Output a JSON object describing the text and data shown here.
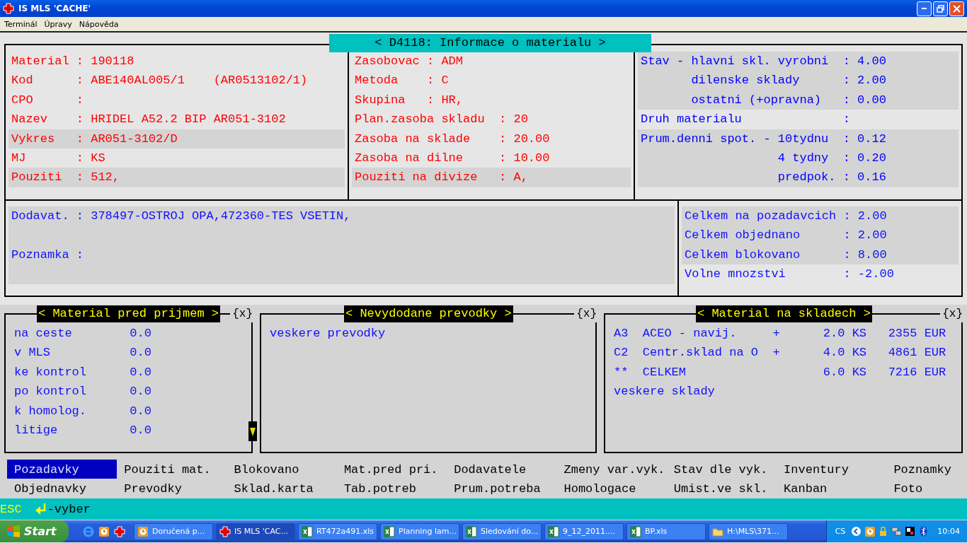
{
  "window": {
    "title": "IS MLS 'CACHE'"
  },
  "menu": [
    "Terminál",
    "Úpravy",
    "Nápověda"
  ],
  "screen_title": "< D4118: Informace o materialu >",
  "material_info": {
    "columns": [
      {
        "color": "#ff0000",
        "lines": [
          {
            "text": "Material : 190118",
            "highlighted": false
          },
          {
            "text": "Kod      : ABE140AL005/1    (AR0513102/1)",
            "highlighted": false
          },
          {
            "text": "CPO      :",
            "highlighted": false
          },
          {
            "text": "Nazev    : HRIDEL A52.2 BIP AR051-3102",
            "highlighted": false
          },
          {
            "text": "Vykres   : AR051-3102/D",
            "highlighted": true
          },
          {
            "text": "MJ       : KS",
            "highlighted": false
          },
          {
            "text": "Pouziti  : 512,",
            "highlighted": true
          }
        ]
      },
      {
        "color": "#ff0000",
        "lines": [
          {
            "text": "Zasobovac : ADM",
            "highlighted": false
          },
          {
            "text": "Metoda    : C",
            "highlighted": false
          },
          {
            "text": "Skupina   : HR,",
            "highlighted": false
          },
          {
            "text": "Plan.zasoba skladu  : 20",
            "highlighted": false
          },
          {
            "text": "Zasoba na sklade    : 20.00",
            "highlighted": false
          },
          {
            "text": "Zasoba na dilne     : 10.00",
            "highlighted": false
          },
          {
            "text": "Pouziti na divize   : A,",
            "highlighted": true
          }
        ]
      },
      {
        "color": "#0000ff",
        "lines": [
          {
            "text": "Stav - hlavni skl. vyrobni  : 4.00",
            "highlighted": true
          },
          {
            "text": "       dilenske sklady      : 2.00",
            "highlighted": true
          },
          {
            "text": "       ostatni (+opravna)   : 0.00",
            "highlighted": true
          },
          {
            "text": "Druh materialu              :",
            "highlighted": false
          },
          {
            "text": "Prum.denni spot. - 10tydnu  : 0.12",
            "highlighted": true
          },
          {
            "text": "                   4 tydny  : 0.20",
            "highlighted": true
          },
          {
            "text": "                   predpok. : 0.16",
            "highlighted": true
          }
        ]
      }
    ]
  },
  "supplier_panel": {
    "lines": [
      "Dodavat. : 378497-OSTROJ OPA,472360-TES VSETIN,",
      "Poznamka :"
    ]
  },
  "totals": [
    {
      "text": "Celkem na pozadavcich : 2.00",
      "highlighted": true
    },
    {
      "text": "Celkem objednano      : 2.00",
      "highlighted": true
    },
    {
      "text": "Celkem blokovano      : 8.00",
      "highlighted": true
    },
    {
      "text": "Volne mnozstvi        : -2.00",
      "highlighted": false
    }
  ],
  "boxes": [
    {
      "title": "< Material pred prijmem >",
      "close": "{x}",
      "scroll_down": true,
      "lines": [
        "na ceste        0.0",
        "v MLS           0.0",
        "ke kontrol      0.0",
        "po kontrol      0.0",
        "k homolog.      0.0",
        "litige          0.0"
      ]
    },
    {
      "title": "< Nevydodane prevodky >",
      "close": "{x}",
      "lines": [
        "veskere prevodky"
      ]
    },
    {
      "title": "< Material na skladech >",
      "close": "{x}",
      "lines": [
        "A3  ACEO - navij.     +      2.0 KS   2355 EUR",
        "C2  Centr.sklad na O  +      4.0 KS   4861 EUR",
        "**  CELKEM                   6.0 KS   7216 EUR",
        "veskere sklady"
      ]
    }
  ],
  "function_rows": [
    [
      {
        "label": "Pozadavky",
        "selected": true
      },
      {
        "label": "Pouziti mat.",
        "selected": false
      },
      {
        "label": "Blokovano",
        "selected": false
      },
      {
        "label": "Mat.pred pri.",
        "selected": false
      },
      {
        "label": "Dodavatele",
        "selected": false
      },
      {
        "label": "Zmeny var.vyk.",
        "selected": false
      },
      {
        "label": "Stav dle vyk.",
        "selected": false
      },
      {
        "label": "Inventury",
        "selected": false
      },
      {
        "label": "Poznamky",
        "selected": false
      }
    ],
    [
      {
        "label": "Objednavky",
        "selected": false
      },
      {
        "label": "Prevodky",
        "selected": false
      },
      {
        "label": "Sklad.karta",
        "selected": false
      },
      {
        "label": "Tab.potreb",
        "selected": false
      },
      {
        "label": "Prum.potreba",
        "selected": false
      },
      {
        "label": "Homologace",
        "selected": false
      },
      {
        "label": "Umist.ve skl.",
        "selected": false
      },
      {
        "label": "Kanban",
        "selected": false
      },
      {
        "label": "Foto",
        "selected": false
      }
    ]
  ],
  "status_bar": {
    "key": "ESC",
    "action": "-vyber"
  },
  "taskbar": {
    "start": "Start",
    "tasks": [
      {
        "kind": "clock",
        "label": "Doručená p...",
        "selected": false
      },
      {
        "kind": "cross",
        "label": "IS MLS 'CAC...",
        "selected": true
      },
      {
        "kind": "sheet",
        "label": "RT472a491.xls",
        "selected": false
      },
      {
        "kind": "sheet",
        "label": "Planning lam...",
        "selected": false
      },
      {
        "kind": "sheet",
        "label": "Sledování do...",
        "selected": false
      },
      {
        "kind": "sheet",
        "label": "9_12_2011....",
        "selected": false
      },
      {
        "kind": "sheet",
        "label": "BP.xls",
        "selected": false
      },
      {
        "kind": "folder",
        "label": "H:\\MLS\\371...",
        "selected": false
      }
    ],
    "language": "CS",
    "time": "10:04"
  }
}
